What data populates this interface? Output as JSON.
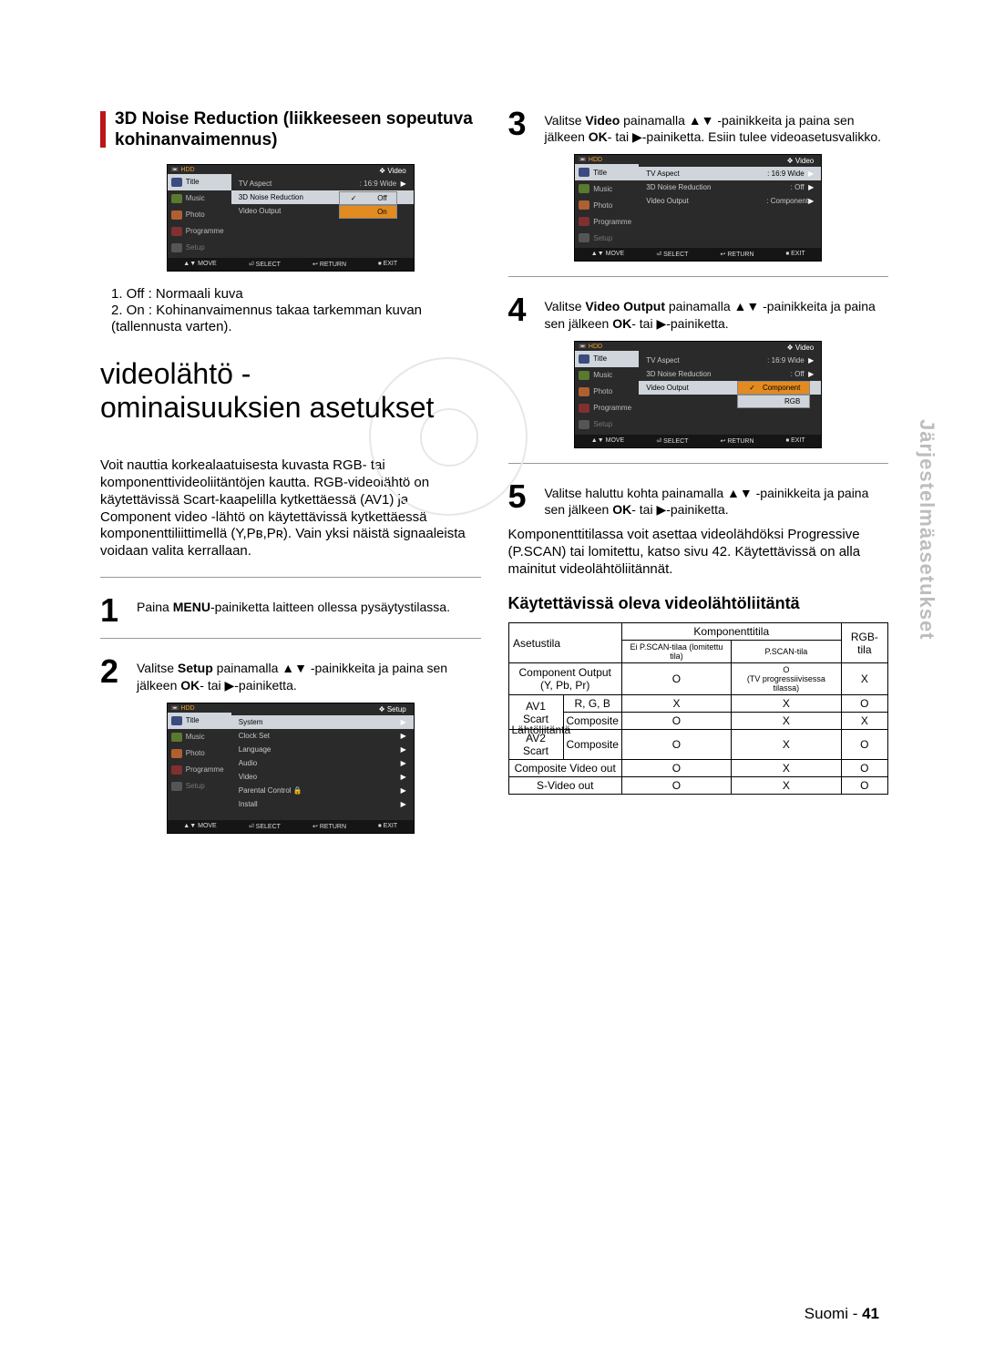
{
  "side_label": "Järjestelmäasetukset",
  "footer": {
    "lang": "Suomi",
    "sep": " - ",
    "page": "41"
  },
  "section_noise": {
    "title": "3D Noise Reduction (liikkeeseen sopeutuva kohinanvaimennus)",
    "items": [
      "1. Off : Normaali kuva",
      "2. On : Kohinanvaimennus takaa tarkemman kuvan (tallennusta varten)."
    ]
  },
  "main_heading": "videolähtö -\nominaisuuksien asetukset",
  "intro": "Voit nauttia korkealaatuisesta kuvasta RGB- tai komponenttivideoliitäntöjen kautta. RGB-videolähtö on käytettävissä Scart-kaapelilla kytkettäessä (AV1) ja Component video -lähtö on käytettävissä kytkettäessä komponenttiliittimellä (Y,Pʙ,Pʀ). Vain yksi näistä signaaleista voidaan valita kerrallaan.",
  "steps": {
    "1": {
      "t": "Paina ",
      "b1": "MENU",
      "t2": "-painiketta laitteen ollessa pysäytystilassa."
    },
    "2": {
      "t": "Valitse ",
      "b1": "Setup",
      "t2": " painamalla ▲▼ -painikkeita ja paina sen jälkeen ",
      "b2": "OK",
      "t3": "- tai ▶-painiketta."
    },
    "3": {
      "t": "Valitse ",
      "b1": "Video",
      "t2": " painamalla ▲▼ -painikkeita ja paina sen jälkeen ",
      "b2": "OK",
      "t3": "- tai ▶-painiketta. Esiin tulee videoasetusvalikko."
    },
    "4": {
      "t": "Valitse ",
      "b1": "Video Output",
      "t2": " painamalla ▲▼ -painikkeita ja paina sen jälkeen ",
      "b2": "OK",
      "t3": "- tai ▶-painiketta."
    },
    "5": {
      "t": "Valitse haluttu kohta painamalla ▲▼ -painikkeita ja paina sen jälkeen ",
      "b1": "OK",
      "t2": "- tai ▶-painiketta."
    }
  },
  "note_after_5": "Komponenttitilassa voit asettaa videolähdöksi Progressive (P.SCAN) tai lomitettu, katso sivu 42. Käytettävissä on alla mainitut videolähtöliitännät.",
  "jacks_heading": "Käytettävissä oleva videolähtöliitäntä",
  "table": {
    "header": {
      "asetustila": "Asetustila",
      "komp": "Komponenttitila",
      "rgb": "RGB-tila",
      "lahto": "Lähtöliitäntä",
      "noPscan": "Ei P.SCAN-tilaa (lomitettu tila)",
      "pscan": "P.SCAN-tila"
    },
    "rows": [
      {
        "jack": "Component Output\n(Y, Pb, Pr)",
        "c1": "O",
        "c2": "O\n(TV progressiivisessa tilassa)",
        "c3": "X"
      },
      {
        "jack": "AV1 Scart",
        "sub": "R, G, B",
        "c1": "X",
        "c2": "X",
        "c3": "O"
      },
      {
        "jack": "",
        "sub": "Composite",
        "c1": "O",
        "c2": "X",
        "c3": "X"
      },
      {
        "jack": "AV2 Scart",
        "sub": "Composite",
        "c1": "O",
        "c2": "X",
        "c3": "O"
      },
      {
        "jack": "Composite Video out",
        "sub": "",
        "c1": "O",
        "c2": "X",
        "c3": "O"
      },
      {
        "jack": "S-Video out",
        "sub": "",
        "c1": "O",
        "c2": "X",
        "c3": "O"
      }
    ]
  },
  "osd": {
    "side": {
      "hdd": "HDD",
      "title": "Title",
      "music": "Music",
      "photo": "Photo",
      "programme": "Programme",
      "setup": "Setup"
    },
    "footer": {
      "move": "MOVE",
      "select": "SELECT",
      "return": "RETURN",
      "exit": "EXIT"
    },
    "crumb_setup": "Setup",
    "crumb_video": "Video",
    "setup_list": [
      "System",
      "Clock Set",
      "Language",
      "Audio",
      "Video",
      "Parental Control",
      "Install"
    ],
    "video_items": {
      "tv_aspect": "TV Aspect",
      "tv_aspect_val": ": 16:9 Wide",
      "noise": "3D Noise Reduction",
      "noise_val_off": ": Off",
      "noise_val_on": ": On",
      "video_out": "Video Output",
      "video_out_val": ": Component"
    },
    "opt3d": {
      "off": "Off",
      "on": "On"
    },
    "optvo": {
      "comp": "Component",
      "rgb": "RGB"
    }
  },
  "icons": {
    "check": "✓",
    "lock": "🔒",
    "diamond": "❖",
    "play": "▶",
    "enter": "⏎",
    "ret": "↩",
    "stop": "⏹",
    "updown": "▲▼"
  }
}
